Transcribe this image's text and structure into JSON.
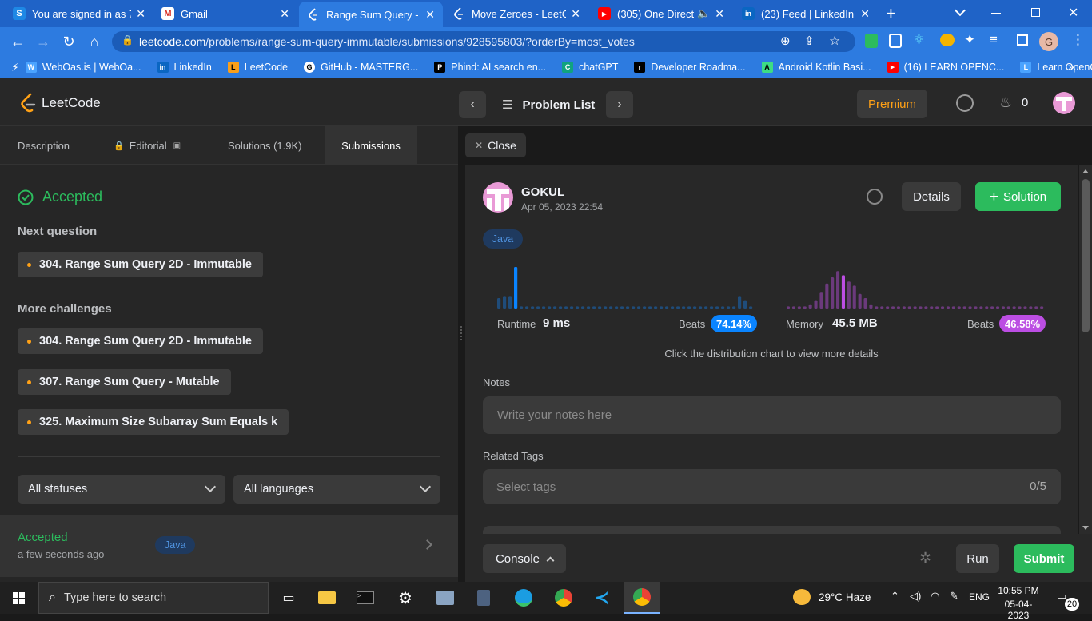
{
  "browser": {
    "tabs": [
      {
        "title": "You are signed in as 7...",
        "icon": "s-icon",
        "color": "#1e88e5",
        "glyph": "S"
      },
      {
        "title": "Gmail",
        "icon": "gmail-icon",
        "color": "#ffffff",
        "glyph": "M"
      },
      {
        "title": "Range Sum Query - Im",
        "icon": "leetcode-icon",
        "color": "#2d7be0",
        "glyph": ""
      },
      {
        "title": "Move Zeroes - LeetCo",
        "icon": "leetcode-icon",
        "color": "#1f63c7",
        "glyph": ""
      },
      {
        "title": "(305) One Directio",
        "icon": "youtube-icon",
        "color": "#ff0000",
        "glyph": "▶"
      },
      {
        "title": "(23) Feed | LinkedIn",
        "icon": "linkedin-icon",
        "color": "#0a66c2",
        "glyph": "in"
      }
    ],
    "url_host": "leetcode.com",
    "url_path": "/problems/range-sum-query-immutable/submissions/928595803/?orderBy=most_votes",
    "bookmarks": [
      {
        "label": "WebOas.is | WebOa...",
        "color": "#4aa3ff",
        "glyph": "W"
      },
      {
        "label": "LinkedIn",
        "color": "#0a66c2",
        "glyph": "in"
      },
      {
        "label": "LeetCode",
        "color": "#f89f1b",
        "glyph": "L"
      },
      {
        "label": "GitHub - MASTERG...",
        "color": "#ffffff",
        "glyph": "G"
      },
      {
        "label": "Phind: AI search en...",
        "color": "#000000",
        "glyph": "P"
      },
      {
        "label": "chatGPT",
        "color": "#10a37f",
        "glyph": "C"
      },
      {
        "label": "Developer Roadma...",
        "color": "#000000",
        "glyph": "r"
      },
      {
        "label": "Android Kotlin Basi...",
        "color": "#3ddc84",
        "glyph": "A"
      },
      {
        "label": "(16) LEARN OPENC...",
        "color": "#ff0000",
        "glyph": "▶"
      },
      {
        "label": "Learn OpenCV in 3...",
        "color": "#4aa3ff",
        "glyph": "L"
      }
    ]
  },
  "header": {
    "logo_text": "LeetCode",
    "problem_list": "Problem List",
    "premium": "Premium",
    "streak": "0"
  },
  "left_tabs": {
    "description": "Description",
    "editorial": "Editorial",
    "solutions": "Solutions (1.9K)",
    "submissions": "Submissions"
  },
  "status": {
    "accepted": "Accepted",
    "next_question_heading": "Next question",
    "next_question": "304. Range Sum Query 2D - Immutable",
    "more_challenges_heading": "More challenges",
    "challenges": [
      "304. Range Sum Query 2D - Immutable",
      "307. Range Sum Query - Mutable",
      "325. Maximum Size Subarray Sum Equals k"
    ]
  },
  "filters": {
    "status": "All statuses",
    "language": "All languages"
  },
  "submission_row": {
    "status": "Accepted",
    "time": "a few seconds ago",
    "language": "Java"
  },
  "right": {
    "close": "Close",
    "user": "GOKUL",
    "date": "Apr 05, 2023 22:54",
    "details": "Details",
    "solution": "Solution",
    "language": "Java",
    "runtime_label": "Runtime",
    "runtime_value": "9 ms",
    "runtime_beats_label": "Beats",
    "runtime_beats": "74.14%",
    "memory_label": "Memory",
    "memory_value": "45.5 MB",
    "memory_beats_label": "Beats",
    "memory_beats": "46.58%",
    "chart_hint": "Click the distribution chart to view more details",
    "notes_label": "Notes",
    "notes_placeholder": "Write your notes here",
    "tags_label": "Related Tags",
    "tags_placeholder": "Select tags",
    "tags_count": "0/5",
    "colors": {
      "runtime": "#0a84ff",
      "memory": "#bc4ee3",
      "accepted": "#2cbb5d",
      "premium": "#ffa116"
    }
  },
  "chart_data": [
    {
      "type": "bar",
      "title": "Runtime",
      "values": [
        0.25,
        0.3,
        0.3,
        1.0,
        0.05,
        0.05,
        0.05,
        0.05,
        0.05,
        0.05,
        0.05,
        0.05,
        0.05,
        0.05,
        0.05,
        0.05,
        0.05,
        0.05,
        0.05,
        0.05,
        0.05,
        0.05,
        0.05,
        0.05,
        0.05,
        0.05,
        0.05,
        0.05,
        0.05,
        0.05,
        0.05,
        0.05,
        0.05,
        0.05,
        0.05,
        0.05,
        0.05,
        0.05,
        0.05,
        0.05,
        0.05,
        0.05,
        0.05,
        0.3,
        0.2,
        0.05
      ],
      "highlight_index": 3
    },
    {
      "type": "bar",
      "title": "Memory",
      "values": [
        0.05,
        0.05,
        0.05,
        0.05,
        0.1,
        0.2,
        0.4,
        0.6,
        0.75,
        0.9,
        0.8,
        0.65,
        0.55,
        0.35,
        0.25,
        0.1,
        0.05,
        0.05,
        0.05,
        0.05,
        0.05,
        0.05,
        0.05,
        0.05,
        0.05,
        0.05,
        0.05,
        0.05,
        0.05,
        0.05,
        0.05,
        0.05,
        0.05,
        0.05,
        0.05,
        0.05,
        0.05,
        0.05,
        0.05,
        0.05,
        0.05,
        0.05,
        0.05,
        0.05,
        0.05,
        0.05,
        0.05
      ],
      "highlight_index": 10
    }
  ],
  "console": {
    "console": "Console",
    "run": "Run",
    "submit": "Submit"
  },
  "taskbar": {
    "search_placeholder": "Type here to search",
    "weather": "29°C  Haze",
    "lang": "ENG",
    "time": "10:55 PM",
    "date": "05-04-2023",
    "notifications": "20"
  }
}
